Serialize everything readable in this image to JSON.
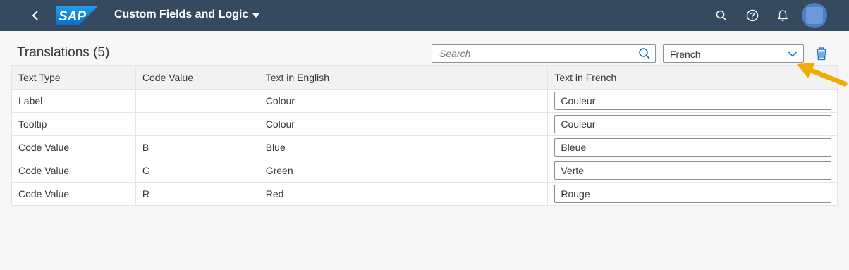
{
  "shell": {
    "app_title": "Custom Fields and Logic",
    "logo_text": "SAP",
    "icons": [
      "back-icon",
      "search-icon",
      "help-icon",
      "notifications-icon",
      "user-avatar"
    ]
  },
  "page": {
    "title": "Translations (5)"
  },
  "search": {
    "placeholder": "Search",
    "value": ""
  },
  "language_select": {
    "selected": "French"
  },
  "table": {
    "headers": [
      "Text Type",
      "Code Value",
      "Text in English",
      "Text in French"
    ],
    "rows": [
      {
        "text_type": "Label",
        "code_value": "",
        "english": "Colour",
        "french": "Couleur"
      },
      {
        "text_type": "Tooltip",
        "code_value": "",
        "english": "Colour",
        "french": "Couleur"
      },
      {
        "text_type": "Code Value",
        "code_value": "B",
        "english": "Blue",
        "french": "Bleue"
      },
      {
        "text_type": "Code Value",
        "code_value": "G",
        "english": "Green",
        "french": "Verte"
      },
      {
        "text_type": "Code Value",
        "code_value": "R",
        "english": "Red",
        "french": "Rouge"
      }
    ]
  },
  "colors": {
    "shell_bg": "#354a5f",
    "accent": "#0a6ed1",
    "annotation_arrow": "#f0ab00"
  }
}
